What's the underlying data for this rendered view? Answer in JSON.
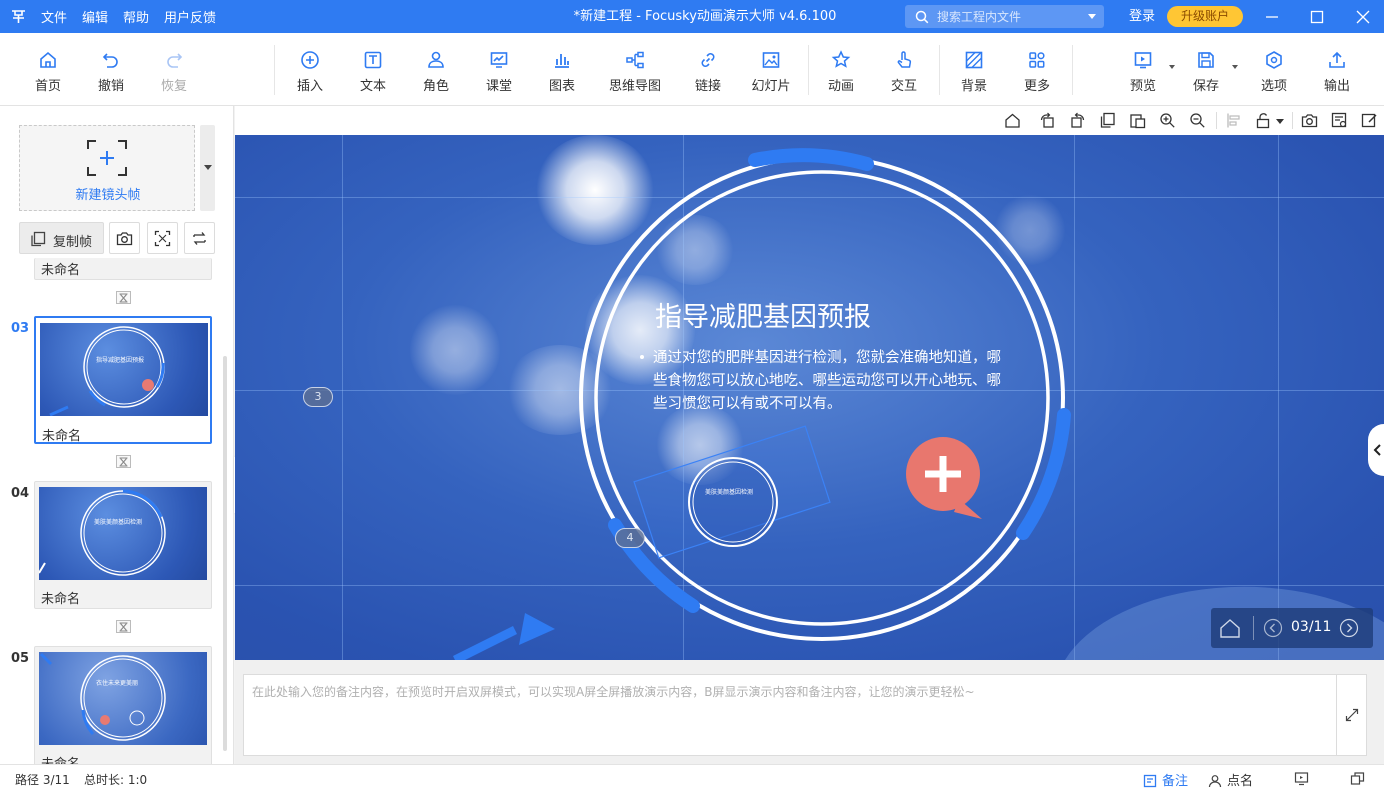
{
  "titlebar": {
    "menu": [
      "文件",
      "编辑",
      "帮助",
      "用户反馈"
    ],
    "title": "*新建工程 - Focusky动画演示大师  v4.6.100",
    "search_placeholder": "搜索工程内文件",
    "login": "登录",
    "upgrade": "升级账户",
    "accent": "#2f7bf2"
  },
  "toolbar": {
    "home": "首页",
    "undo": "撤销",
    "redo": "恢复",
    "insert": "插入",
    "text": "文本",
    "role": "角色",
    "class": "课堂",
    "chart": "图表",
    "mindmap": "思维导图",
    "link": "链接",
    "slides": "幻灯片",
    "animation": "动画",
    "interact": "交互",
    "background": "背景",
    "more": "更多",
    "preview": "预览",
    "save": "保存",
    "options": "选项",
    "export": "输出"
  },
  "leftpanel": {
    "new_frame": "新建镜头帧",
    "copy_frame": "复制帧",
    "partial_name": "未命名",
    "thumbs": [
      {
        "num": "03",
        "name": "未命名",
        "title": "指导减肥基因预报",
        "active": true
      },
      {
        "num": "04",
        "name": "未命名",
        "title": "美肤美颜基因检测",
        "active": false
      },
      {
        "num": "05",
        "name": "未命名",
        "title": "衣住未来更美丽",
        "active": false
      }
    ]
  },
  "slide": {
    "title": "指导减肥基因预报",
    "body": "通过对您的肥胖基因进行检测，您就会准确地知道，哪些食物您可以放心地吃、哪些运动您可以开心地玩、哪些习惯您可以有或不可以有。",
    "path_num_left": "3",
    "path_num_inner": "4",
    "page": "03/11"
  },
  "notes": {
    "placeholder": "在此处输入您的备注内容，在预览时开启双屏模式，可以实现A屏全屏播放演示内容，B屏显示演示内容和备注内容，让您的演示更轻松~"
  },
  "status": {
    "path": "路径 3/11",
    "duration": "总时长: 1:0",
    "notes_btn": "备注",
    "rollcall_btn": "点名"
  }
}
